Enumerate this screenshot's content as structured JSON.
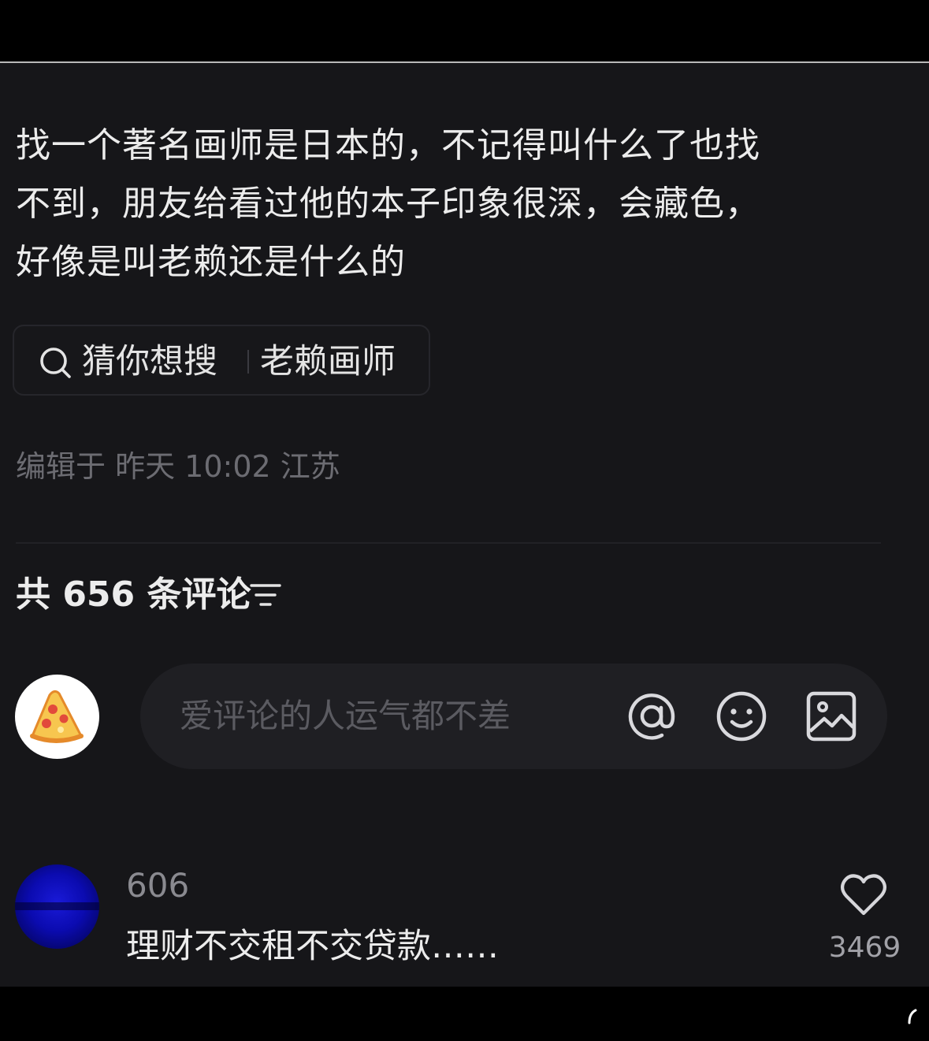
{
  "post": {
    "lines": [
      "找一个著名画师是日本的，不记得叫什么了也找",
      "不到，朋友给看过他的本子印象很深，会藏色，",
      "好像是叫老赖还是什么的"
    ],
    "suggest_label": "猜你想搜",
    "suggest_query": "老赖画师",
    "edit_meta": "编辑于 昨天 10:02 江苏"
  },
  "comments": {
    "count_label": "共 656 条评论",
    "input_placeholder": "爱评论的人运气都不差",
    "items": [
      {
        "user": "606",
        "text": "理财不交租不交贷款……",
        "likes": "3469"
      }
    ]
  },
  "icons": {
    "search": "search-icon",
    "sort": "sort-icon",
    "at": "at-icon",
    "emoji": "emoji-icon",
    "image": "image-icon",
    "like": "heart-icon"
  },
  "colors": {
    "background": "#161619",
    "text_primary": "#ececec",
    "text_secondary": "#6c6c72",
    "input_background": "#1f1f23"
  }
}
